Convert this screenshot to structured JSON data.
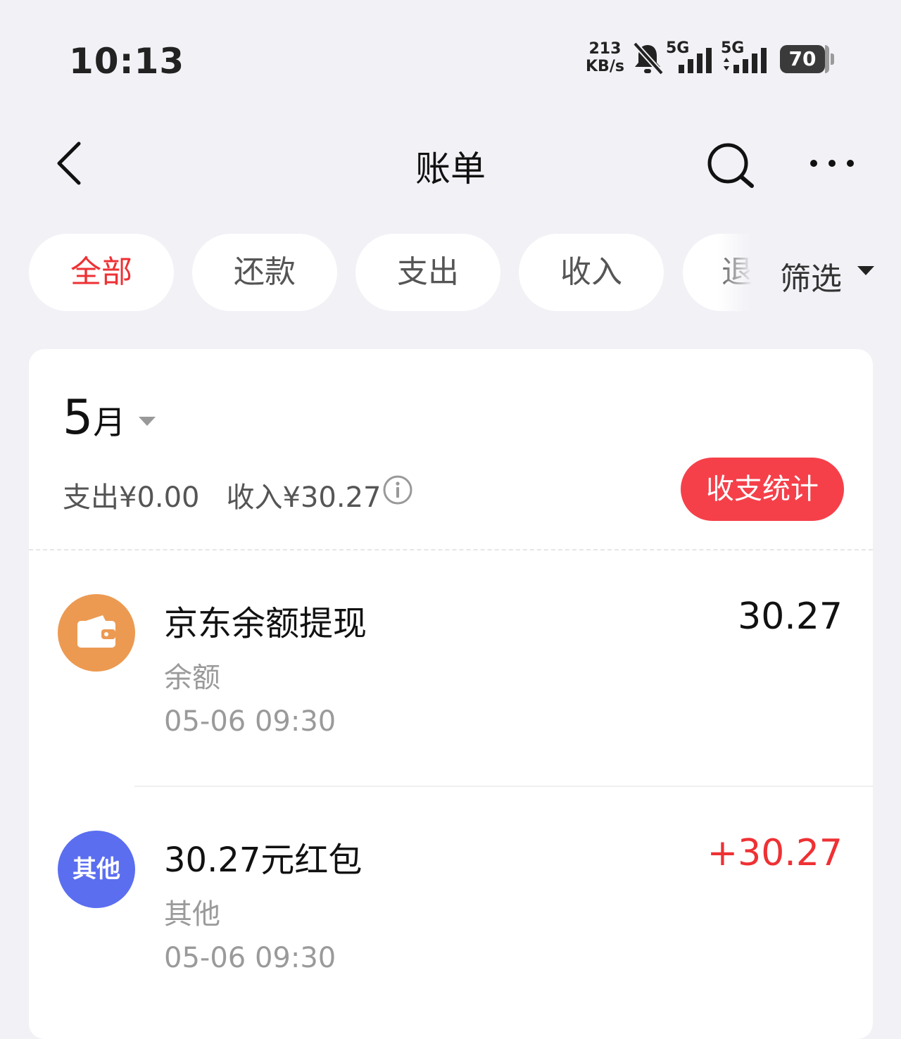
{
  "status": {
    "time": "10:13",
    "net_speed_value": "213",
    "net_speed_unit": "KB/s",
    "sim1_label": "5G",
    "sim2_label": "5G",
    "battery": "70"
  },
  "nav": {
    "title": "账单",
    "back_icon": "chevron-left-icon",
    "search_icon": "search-icon",
    "more_icon": "more-icon"
  },
  "tabs": [
    {
      "label": "全部",
      "active": true
    },
    {
      "label": "还款",
      "active": false
    },
    {
      "label": "支出",
      "active": false
    },
    {
      "label": "收入",
      "active": false
    },
    {
      "label": "退",
      "active": false
    }
  ],
  "filter": {
    "label": "筛选"
  },
  "month": {
    "number": "5",
    "unit": "月",
    "expense": "支出¥0.00",
    "income": "收入¥30.27",
    "stats_button": "收支统计"
  },
  "transactions": [
    {
      "title": "京东余额提现",
      "category": "余额",
      "time": "05-06 09:30",
      "amount": "30.27",
      "icon": "wallet-icon",
      "icon_color": "#ec9a52"
    },
    {
      "title": "30.27元红包",
      "category": "其他",
      "time": "05-06 09:30",
      "amount": "+30.27",
      "icon_label": "其他",
      "icon_color": "#5b6ef0"
    }
  ],
  "colors": {
    "accent": "#ee3134",
    "button": "#f5404a",
    "background": "#f1f1f6"
  }
}
